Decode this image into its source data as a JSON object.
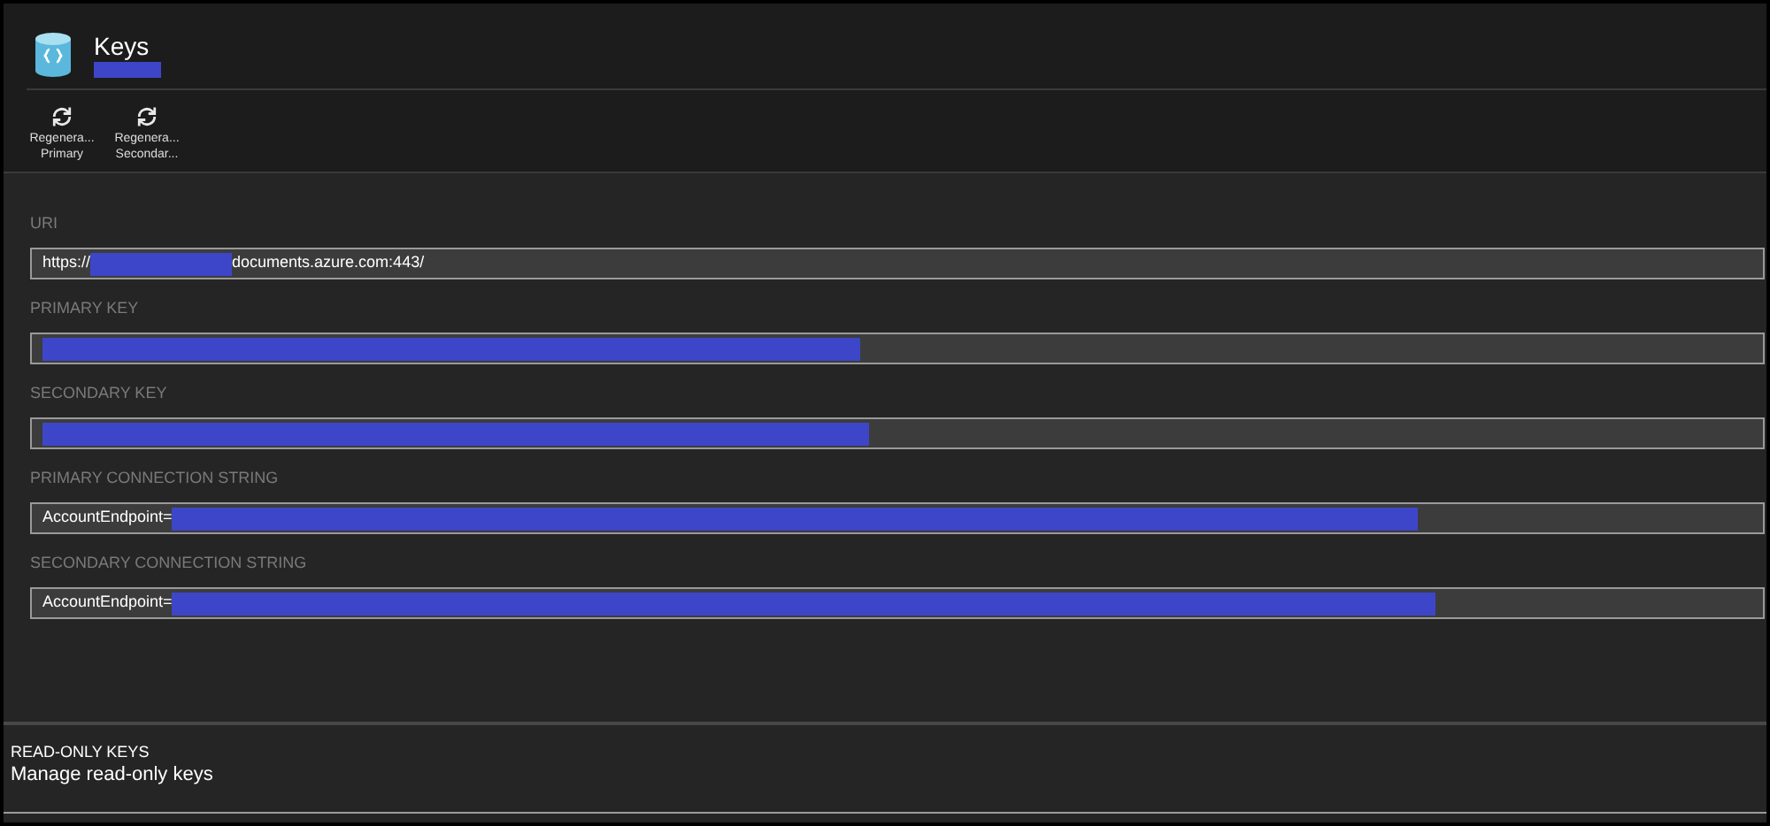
{
  "blade": {
    "title": "Keys"
  },
  "toolbar": [
    {
      "label": "Regenera... Primary"
    },
    {
      "label": "Regenera... Secondar..."
    }
  ],
  "fields": [
    {
      "label": "URI",
      "segments": [
        {
          "kind": "text",
          "text": "https://"
        },
        {
          "kind": "redacted"
        },
        {
          "kind": "text",
          "text": "documents.azure.com:443/"
        }
      ]
    },
    {
      "label": "PRIMARY KEY",
      "segments": [
        {
          "kind": "redacted"
        }
      ]
    },
    {
      "label": "SECONDARY KEY",
      "segments": [
        {
          "kind": "redacted"
        }
      ]
    },
    {
      "label": "PRIMARY CONNECTION STRING",
      "segments": [
        {
          "kind": "text",
          "text": "AccountEndpoint="
        },
        {
          "kind": "redacted"
        }
      ]
    },
    {
      "label": "SECONDARY CONNECTION STRING",
      "segments": [
        {
          "kind": "text",
          "text": "AccountEndpoint="
        },
        {
          "kind": "redacted"
        }
      ]
    }
  ],
  "readonly_section": {
    "title": "READ-ONLY KEYS",
    "subtitle": "Manage read-only keys"
  }
}
